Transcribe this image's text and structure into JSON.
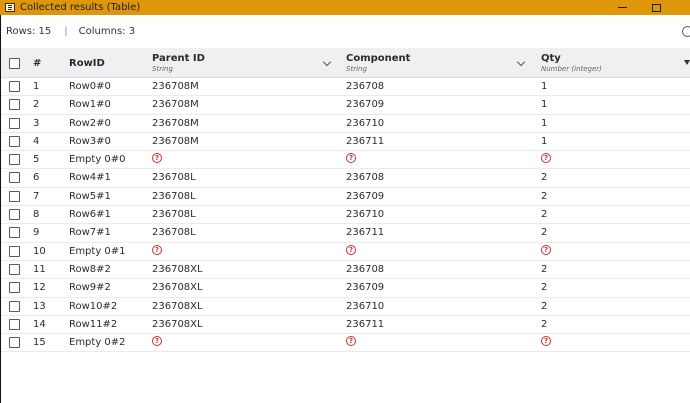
{
  "window": {
    "title": "Collected results (Table)",
    "app_icon": "table-icon",
    "accent": "#e0960a"
  },
  "info": {
    "rows": "Rows: 15",
    "separator": "|",
    "columns": "Columns: 3"
  },
  "table": {
    "headers": {
      "num": "#",
      "rowid": "RowID",
      "parent": {
        "name": "Parent ID",
        "type": "String"
      },
      "component": {
        "name": "Component",
        "type": "String"
      },
      "qty": {
        "name": "Qty",
        "type": "Number (integer)"
      }
    },
    "missing_icon": "?",
    "missing_color": "#d32f2f",
    "rows": [
      {
        "num": "1",
        "rowid": "Row0#0",
        "parent": "236708M",
        "component": "236708",
        "qty": "1",
        "missing": false
      },
      {
        "num": "2",
        "rowid": "Row1#0",
        "parent": "236708M",
        "component": "236709",
        "qty": "1",
        "missing": false
      },
      {
        "num": "3",
        "rowid": "Row2#0",
        "parent": "236708M",
        "component": "236710",
        "qty": "1",
        "missing": false
      },
      {
        "num": "4",
        "rowid": "Row3#0",
        "parent": "236708M",
        "component": "236711",
        "qty": "1",
        "missing": false
      },
      {
        "num": "5",
        "rowid": "Empty 0#0",
        "parent": "",
        "component": "",
        "qty": "",
        "missing": true
      },
      {
        "num": "6",
        "rowid": "Row4#1",
        "parent": "236708L",
        "component": "236708",
        "qty": "2",
        "missing": false
      },
      {
        "num": "7",
        "rowid": "Row5#1",
        "parent": "236708L",
        "component": "236709",
        "qty": "2",
        "missing": false
      },
      {
        "num": "8",
        "rowid": "Row6#1",
        "parent": "236708L",
        "component": "236710",
        "qty": "2",
        "missing": false
      },
      {
        "num": "9",
        "rowid": "Row7#1",
        "parent": "236708L",
        "component": "236711",
        "qty": "2",
        "missing": false
      },
      {
        "num": "10",
        "rowid": "Empty 0#1",
        "parent": "",
        "component": "",
        "qty": "",
        "missing": true
      },
      {
        "num": "11",
        "rowid": "Row8#2",
        "parent": "236708XL",
        "component": "236708",
        "qty": "2",
        "missing": false
      },
      {
        "num": "12",
        "rowid": "Row9#2",
        "parent": "236708XL",
        "component": "236709",
        "qty": "2",
        "missing": false
      },
      {
        "num": "13",
        "rowid": "Row10#2",
        "parent": "236708XL",
        "component": "236710",
        "qty": "2",
        "missing": false
      },
      {
        "num": "14",
        "rowid": "Row11#2",
        "parent": "236708XL",
        "component": "236711",
        "qty": "2",
        "missing": false
      },
      {
        "num": "15",
        "rowid": "Empty 0#2",
        "parent": "",
        "component": "",
        "qty": "",
        "missing": true
      }
    ]
  }
}
